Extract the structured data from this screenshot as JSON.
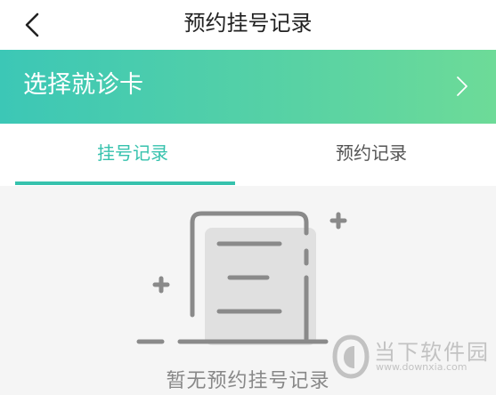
{
  "header": {
    "title": "预约挂号记录",
    "back_icon": "chevron-left-icon"
  },
  "card_selector": {
    "label": "选择就诊卡",
    "arrow_icon": "chevron-right-icon",
    "gradient_start": "#3cc7b6",
    "gradient_end": "#6ddb98"
  },
  "tabs": [
    {
      "label": "挂号记录",
      "active": true
    },
    {
      "label": "预约记录",
      "active": false
    }
  ],
  "accent_color": "#36c2ad",
  "empty_state": {
    "icon": "empty-document-icon",
    "text": "暂无预约挂号记录"
  },
  "watermark": {
    "name": "当下软件园",
    "url": "www.downxia.com",
    "icon": "downxia-logo-icon"
  }
}
